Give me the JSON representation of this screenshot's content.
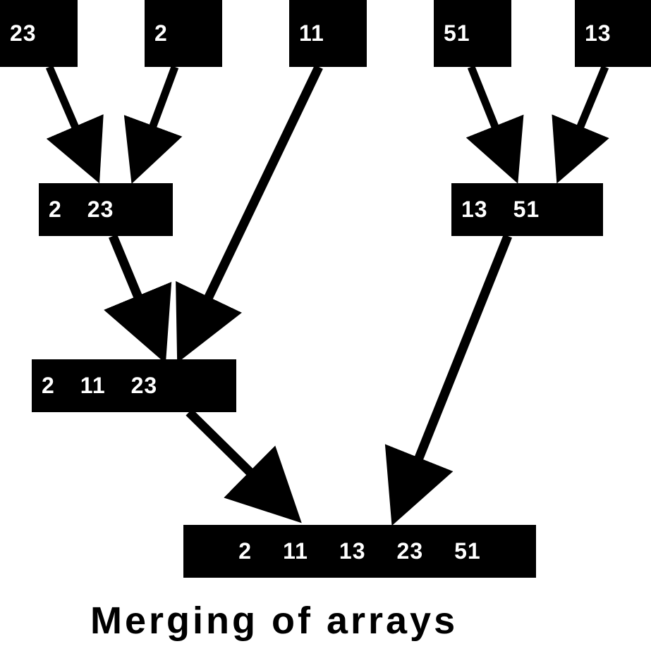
{
  "level0": {
    "box0": {
      "values": [
        "23"
      ]
    },
    "box1": {
      "values": [
        "2"
      ]
    },
    "box2": {
      "values": [
        "11"
      ]
    },
    "box3": {
      "values": [
        "51"
      ]
    },
    "box4": {
      "values": [
        "13"
      ]
    }
  },
  "level1": {
    "boxA": {
      "values": [
        "2",
        "23"
      ]
    },
    "boxB": {
      "values": [
        "13",
        "51"
      ]
    }
  },
  "level2": {
    "boxC": {
      "values": [
        "2",
        "11",
        "23"
      ]
    }
  },
  "level3": {
    "boxD": {
      "values": [
        "2",
        "11",
        "13",
        "23",
        "51"
      ]
    }
  },
  "caption": "Merging of arrays"
}
